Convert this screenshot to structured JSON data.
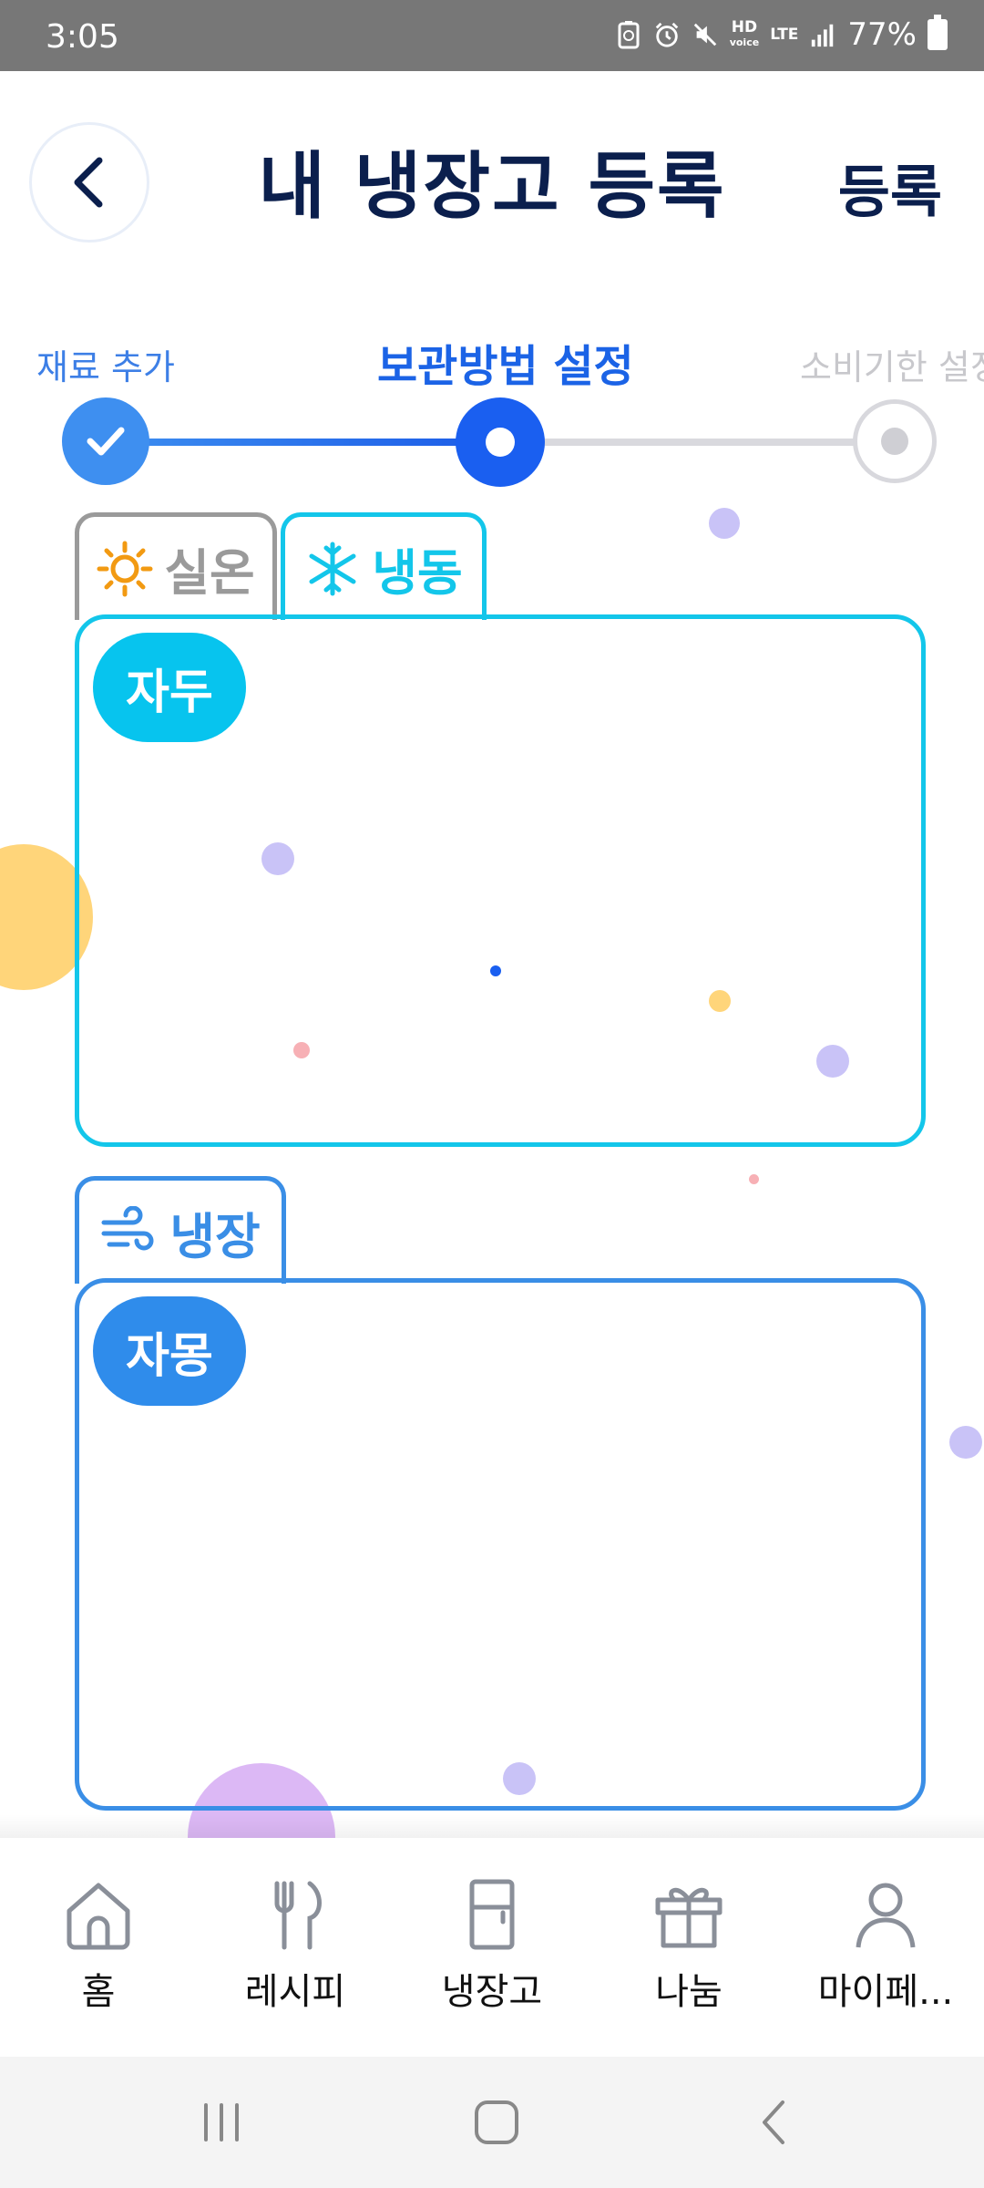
{
  "status_bar": {
    "time": "3:05",
    "battery": "77%",
    "hd_label": "HD",
    "voice_label": "voice",
    "lte_label": "LTE"
  },
  "header": {
    "title": "내 냉장고 등록",
    "register_label": "등록"
  },
  "stepper": {
    "steps": [
      {
        "label": "재료 추가",
        "state": "done"
      },
      {
        "label": "보관방법 설정",
        "state": "current"
      },
      {
        "label": "소비기한 설정",
        "state": "todo"
      }
    ]
  },
  "storage": {
    "tab_room": "실온",
    "tab_freeze": "냉동",
    "tab_fridge": "냉장",
    "freeze_items": [
      "자두"
    ],
    "fridge_items": [
      "자몽"
    ]
  },
  "bottom_nav": {
    "items": [
      {
        "label": "홈",
        "icon": "home-icon"
      },
      {
        "label": "레시피",
        "icon": "fork-knife-icon"
      },
      {
        "label": "냉장고",
        "icon": "fridge-icon"
      },
      {
        "label": "나눔",
        "icon": "gift-icon"
      },
      {
        "label": "마이페...",
        "icon": "person-icon"
      }
    ]
  },
  "colors": {
    "primary": "#1a5ff0",
    "freeze": "#13c6ea",
    "fridge": "#3a8ee6",
    "title": "#0b1f4d"
  }
}
